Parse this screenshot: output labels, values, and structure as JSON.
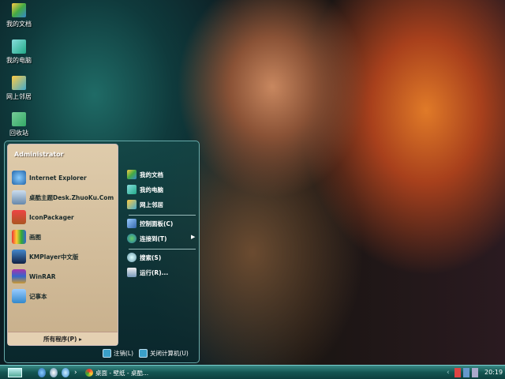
{
  "desktop_icons": [
    {
      "label": "我的文档"
    },
    {
      "label": "我的电脑"
    },
    {
      "label": "网上邻居"
    },
    {
      "label": "回收站"
    }
  ],
  "start_menu": {
    "user": "Administrator",
    "programs": [
      {
        "label": "Internet Explorer"
      },
      {
        "label": "桌酷主题Desk.ZhuoKu.Com"
      },
      {
        "label": "IconPackager"
      },
      {
        "label": "画图"
      },
      {
        "label": "KMPlayer中文版"
      },
      {
        "label": "WinRAR"
      },
      {
        "label": "记事本"
      }
    ],
    "all_programs": "所有程序(P)",
    "right_items": [
      {
        "label": "我的文档"
      },
      {
        "label": "我的电脑"
      },
      {
        "label": "网上邻居"
      },
      {
        "label": "控制面板(C)"
      },
      {
        "label": "连接到(T)"
      },
      {
        "label": "搜索(S)"
      },
      {
        "label": "运行(R)..."
      }
    ],
    "logoff": "注销(L)",
    "shutdown": "关闭计算机(U)"
  },
  "taskbar": {
    "task_label": "桌面 - 壁纸 - 桌酷...",
    "clock": "20:19",
    "chevron": "›",
    "tray_expand": "‹"
  }
}
